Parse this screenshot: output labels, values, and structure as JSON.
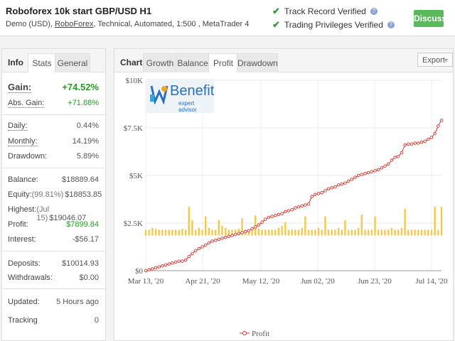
{
  "header": {
    "title": "Roboforex 10k start GBP/USD H1",
    "sub_pre": "Demo (USD), ",
    "sub_broker": "RoboForex",
    "sub_post": ", Technical, Automated, 1:500 , MetaTrader 4",
    "track_record": "Track Record Verified",
    "trading_privileges": "Trading Privileges Verified",
    "discuss": "Discuss"
  },
  "left": {
    "tabs": [
      "Info",
      "Stats",
      "General"
    ],
    "gain_label": "Gain:",
    "gain_value": "+74.52%",
    "abs_gain_label": "Abs. Gain:",
    "abs_gain_value": "+71.88%",
    "daily_label": "Daily:",
    "daily_value": "0.44%",
    "monthly_label": "Monthly:",
    "monthly_value": "14.19%",
    "drawdown_label": "Drawdown:",
    "drawdown_value": "5.89%",
    "balance_label": "Balance:",
    "balance_value": "$18889.64",
    "equity_label": "Equity:",
    "equity_pre": "(99.81%)",
    "equity_value": "$18853.85",
    "highest_label": "Highest:",
    "highest_pre": "(Jul 15)",
    "highest_value": "$19046.07",
    "profit_label": "Profit:",
    "profit_value": "$7899.84",
    "interest_label": "Interest:",
    "interest_value": "-$56.17",
    "deposits_label": "Deposits:",
    "deposits_value": "$10014.93",
    "withdrawals_label": "Withdrawals:",
    "withdrawals_value": "$0.00",
    "updated_label": "Updated:",
    "updated_value": "5 Hours ago",
    "tracking_label": "Tracking",
    "tracking_value": "0"
  },
  "right": {
    "chart_tab": "Chart",
    "tabs": [
      "Growth",
      "Balance",
      "Profit",
      "Drawdown"
    ],
    "export": "Export",
    "logo_text": "Benefit",
    "logo_sub": "expert advisor",
    "legend": "Profit"
  },
  "colors": {
    "profit_line": "#d9342b",
    "bars": "#f2c94c",
    "green": "#2a9a2a",
    "discuss": "#5cb85c"
  },
  "chart_data": {
    "type": "line",
    "y_ticks": [
      "$10K",
      "$7.5K",
      "$5K",
      "$2.5K",
      "$0"
    ],
    "x_ticks": [
      "Mar 13, '20",
      "Apr 21, '20",
      "May 12, '20",
      "Jun 02, '20",
      "Jun 23, '20",
      "Jul 14, '20"
    ],
    "ylim": [
      0,
      10000
    ],
    "series": [
      {
        "name": "Profit",
        "values": [
          0,
          50,
          100,
          150,
          200,
          250,
          300,
          350,
          400,
          450,
          500,
          500,
          550,
          750,
          900,
          1050,
          1150,
          1250,
          1350,
          1450,
          1550,
          1600,
          1650,
          1700,
          1750,
          1800,
          1850,
          1900,
          1950,
          2000,
          2050,
          2100,
          2200,
          2300,
          2400,
          2550,
          2700,
          2800,
          2850,
          2900,
          2950,
          3000,
          3100,
          3150,
          3200,
          3300,
          3350,
          3400,
          3450,
          3500,
          3900,
          4000,
          4050,
          4100,
          4200,
          4300,
          4350,
          4400,
          4500,
          4550,
          4600,
          4700,
          4800,
          4900,
          5000,
          5050,
          5100,
          5150,
          5200,
          5250,
          5300,
          5400,
          5500,
          5600,
          5800,
          5950,
          6000,
          6200,
          6600,
          6650,
          6650,
          6700,
          6700,
          6750,
          6800,
          6900,
          7000,
          7200,
          7600,
          7900
        ]
      },
      {
        "name": "bars",
        "values": [
          300,
          300,
          400,
          350,
          300,
          300,
          300,
          300,
          300,
          300,
          300,
          350,
          300,
          1500,
          800,
          300,
          400,
          300,
          1000,
          400,
          300,
          300,
          800,
          500,
          400,
          300,
          300,
          300,
          350,
          900,
          300,
          300,
          400,
          1050,
          350,
          300,
          300,
          300,
          300,
          300,
          400,
          500,
          700,
          300,
          300,
          300,
          300,
          400,
          1000,
          300,
          300,
          300,
          400,
          300,
          1000,
          300,
          300,
          300,
          400,
          300,
          800,
          300,
          300,
          300,
          400,
          1100,
          300,
          300,
          300,
          1000,
          300,
          300,
          300,
          300,
          400,
          300,
          300,
          400,
          1400,
          300,
          300,
          300,
          300,
          300,
          300,
          300,
          300,
          1500,
          300,
          1500
        ]
      }
    ]
  }
}
